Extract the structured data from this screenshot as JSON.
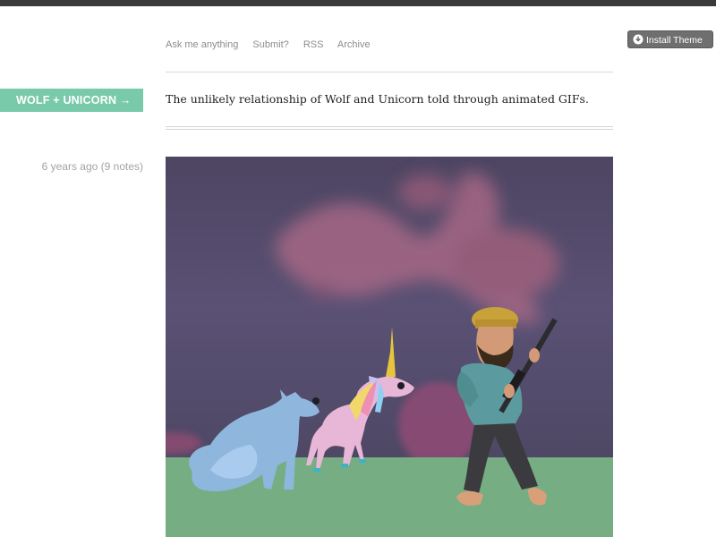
{
  "nav": {
    "links": [
      "Ask me anything",
      "Submit?",
      "RSS",
      "Archive"
    ]
  },
  "theme": {
    "install_label": "Install Theme",
    "accent": "#79c9ab",
    "topbar": "#3a3a3a"
  },
  "blog": {
    "title": "WOLF + UNICORN →",
    "description": "The unlikely relationship of Wolf and Unicorn told through animated GIFs."
  },
  "post": {
    "meta": "6 years ago (9 notes)"
  }
}
